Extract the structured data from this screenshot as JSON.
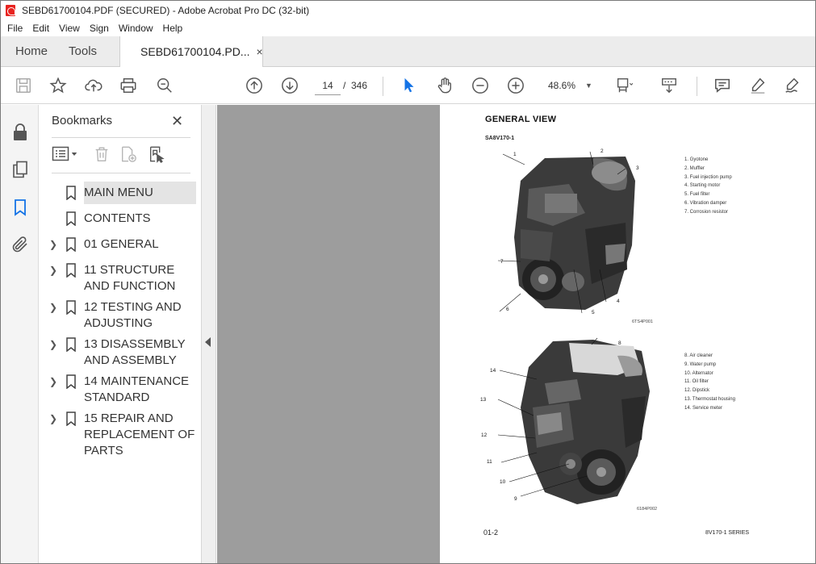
{
  "window": {
    "title": "SEBD61700104.PDF (SECURED) - Adobe Acrobat Pro DC (32-bit)"
  },
  "menubar": [
    "File",
    "Edit",
    "View",
    "Sign",
    "Window",
    "Help"
  ],
  "tabs": {
    "home": "Home",
    "tools": "Tools",
    "document": "SEBD61700104.PD...",
    "close": "×"
  },
  "toolbar": {
    "current_page": "14",
    "page_separator": "/",
    "total_pages": "346",
    "zoom": "48.6%"
  },
  "bookmarks": {
    "header": "Bookmarks",
    "close": "✕",
    "items": [
      {
        "label": "MAIN MENU",
        "expandable": false,
        "selected": true
      },
      {
        "label": "CONTENTS",
        "expandable": false,
        "selected": false
      },
      {
        "label": "01 GENERAL",
        "expandable": true,
        "selected": false
      },
      {
        "label": "11 STRUCTURE AND FUNCTION",
        "expandable": true,
        "selected": false
      },
      {
        "label": "12 TESTING AND ADJUSTING",
        "expandable": true,
        "selected": false
      },
      {
        "label": "13 DISASSEMBLY AND ASSEMBLY",
        "expandable": true,
        "selected": false
      },
      {
        "label": "14 MAINTENANCE STANDARD",
        "expandable": true,
        "selected": false
      },
      {
        "label": "15 REPAIR AND REPLACEMENT OF PARTS",
        "expandable": true,
        "selected": false
      }
    ]
  },
  "page": {
    "title": "GENERAL VIEW",
    "model": "SA8V170-1",
    "figure1": {
      "code": "6TS4P001",
      "legend": [
        "1.  Gyotone",
        "2.  Muffler",
        "3.  Fuel injection pump",
        "4.  Starting motor",
        "5.  Fuel filter",
        "6.  Vibration damper",
        "7.  Corrosion resistor"
      ],
      "callouts": [
        "1",
        "2",
        "3",
        "7",
        "6",
        "5",
        "4"
      ]
    },
    "figure2": {
      "code": "6184P002",
      "legend": [
        "8.  Air cleaner",
        "9.  Water pump",
        "10.  Alternator",
        "11.  Oil filter",
        "12.  Dipstick",
        "13.  Thermostat housing",
        "14.  Service meter"
      ],
      "callouts": [
        "8",
        "14",
        "13",
        "12",
        "11",
        "10",
        "9"
      ]
    },
    "footer_page": "01-2",
    "footer_series": "8V170-1 SERIES"
  }
}
